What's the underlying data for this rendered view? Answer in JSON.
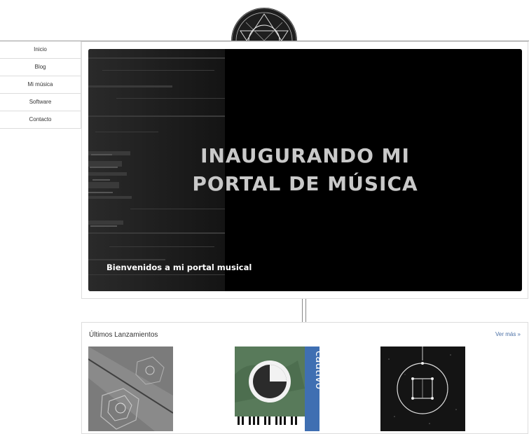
{
  "nav": {
    "items": [
      {
        "label": "Inicio"
      },
      {
        "label": "Blog"
      },
      {
        "label": "Mi música"
      },
      {
        "label": "Software"
      },
      {
        "label": "Contacto"
      }
    ]
  },
  "hero": {
    "title_line1": "INAUGURANDO MI",
    "title_line2": "PORTAL DE MÚSICA",
    "caption": "Bienvenidos a mi portal musical"
  },
  "releases": {
    "title": "Últimos Lanzamientos",
    "more_label": "Ver más »",
    "items": [
      {
        "name": "rose-album-cover"
      },
      {
        "name": "cautivo-album-cover",
        "cover_text": "cautivo"
      },
      {
        "name": "constellation-album-cover"
      }
    ]
  },
  "colors": {
    "hero_bg": "#000000",
    "hero_title": "#c9c9c9",
    "link": "#4a6fa5",
    "border": "#dddddd"
  }
}
